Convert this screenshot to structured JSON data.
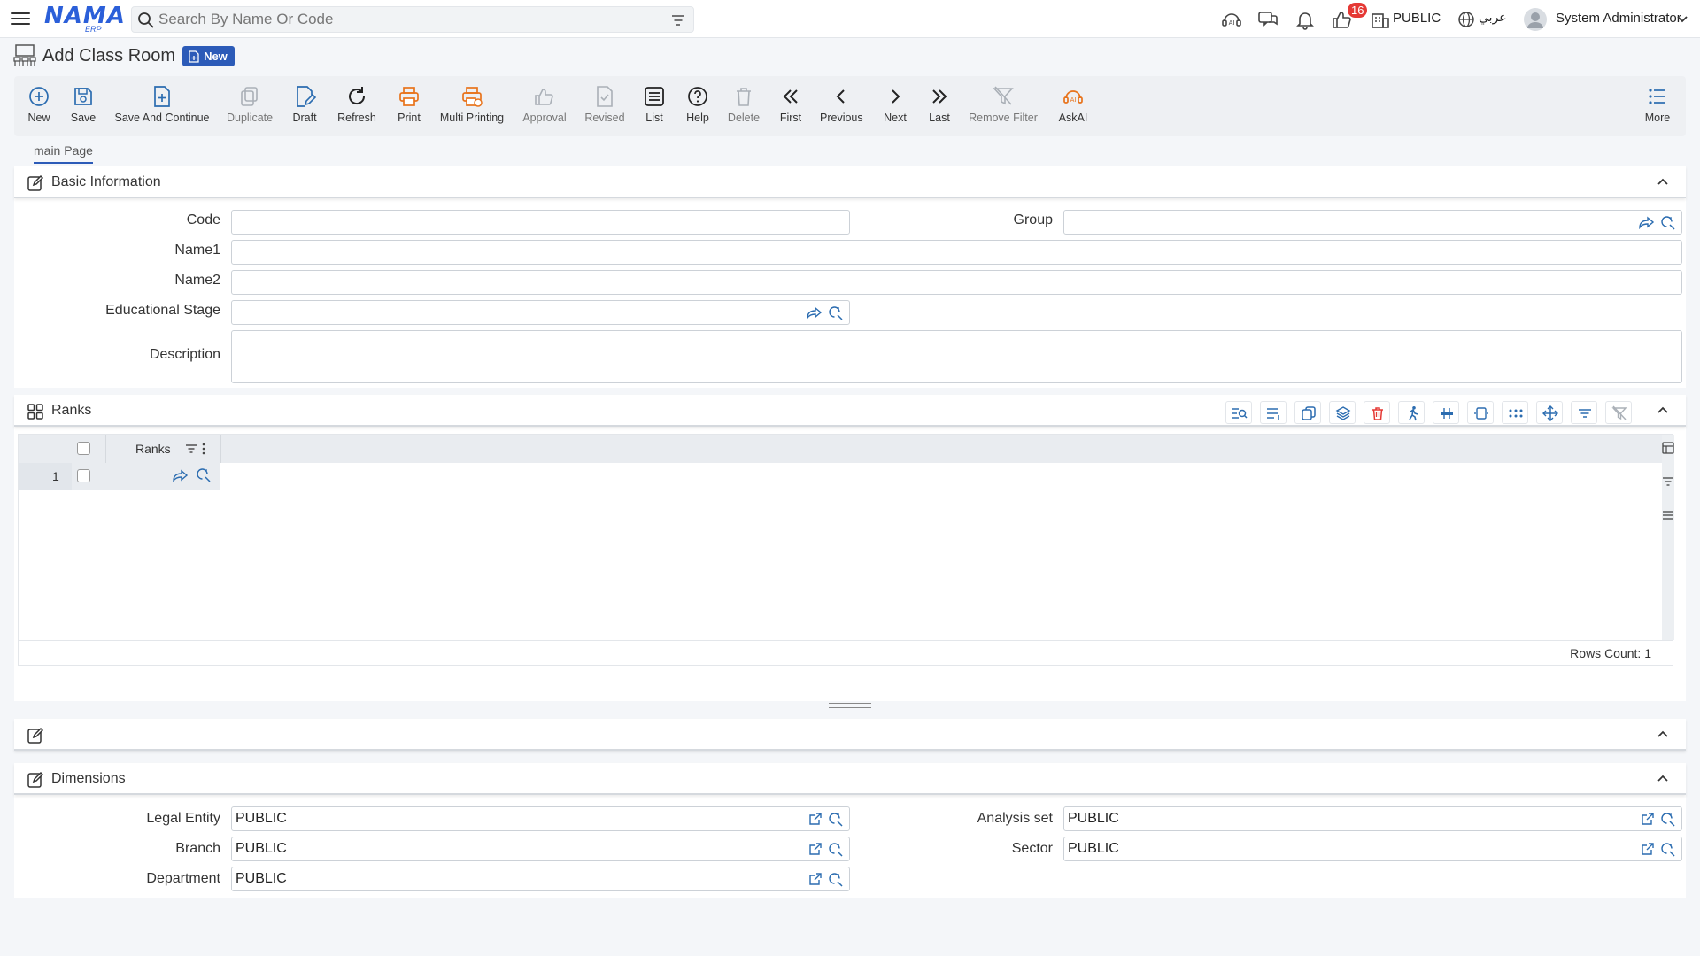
{
  "topbar": {
    "logo_main": "NAMA",
    "logo_sub": "ERP",
    "search_placeholder": "Search By Name Or Code",
    "notification_count": "16",
    "company": "PUBLIC",
    "language": "عربي",
    "user": "System Administrator"
  },
  "page": {
    "title": "Add Class Room",
    "status": "New"
  },
  "toolbar": {
    "new": "New",
    "save": "Save",
    "save_continue": "Save And Continue",
    "duplicate": "Duplicate",
    "draft": "Draft",
    "refresh": "Refresh",
    "print": "Print",
    "multi_printing": "Multi Printing",
    "approval": "Approval",
    "revised": "Revised",
    "list": "List",
    "help": "Help",
    "delete": "Delete",
    "first": "First",
    "previous": "Previous",
    "next": "Next",
    "last": "Last",
    "remove_filter": "Remove Filter",
    "askai": "AskAI",
    "more": "More"
  },
  "tabs": {
    "main": "main Page"
  },
  "basic": {
    "title": "Basic Information",
    "code_label": "Code",
    "group_label": "Group",
    "name1_label": "Name1",
    "name2_label": "Name2",
    "stage_label": "Educational Stage",
    "description_label": "Description"
  },
  "ranks": {
    "title": "Ranks",
    "column": "Ranks",
    "row_number": "1",
    "rows_count": "Rows Count: 1"
  },
  "dimensions": {
    "title": "Dimensions",
    "legal_entity_label": "Legal Entity",
    "legal_entity_value": "PUBLIC",
    "analysis_set_label": "Analysis set",
    "analysis_set_value": "PUBLIC",
    "branch_label": "Branch",
    "branch_value": "PUBLIC",
    "sector_label": "Sector",
    "sector_value": "PUBLIC",
    "department_label": "Department",
    "department_value": "PUBLIC"
  },
  "colors": {
    "accent": "#2c5bb8",
    "icon_blue": "#2b6cb0",
    "icon_orange": "#e8731b",
    "danger": "#e53935"
  }
}
